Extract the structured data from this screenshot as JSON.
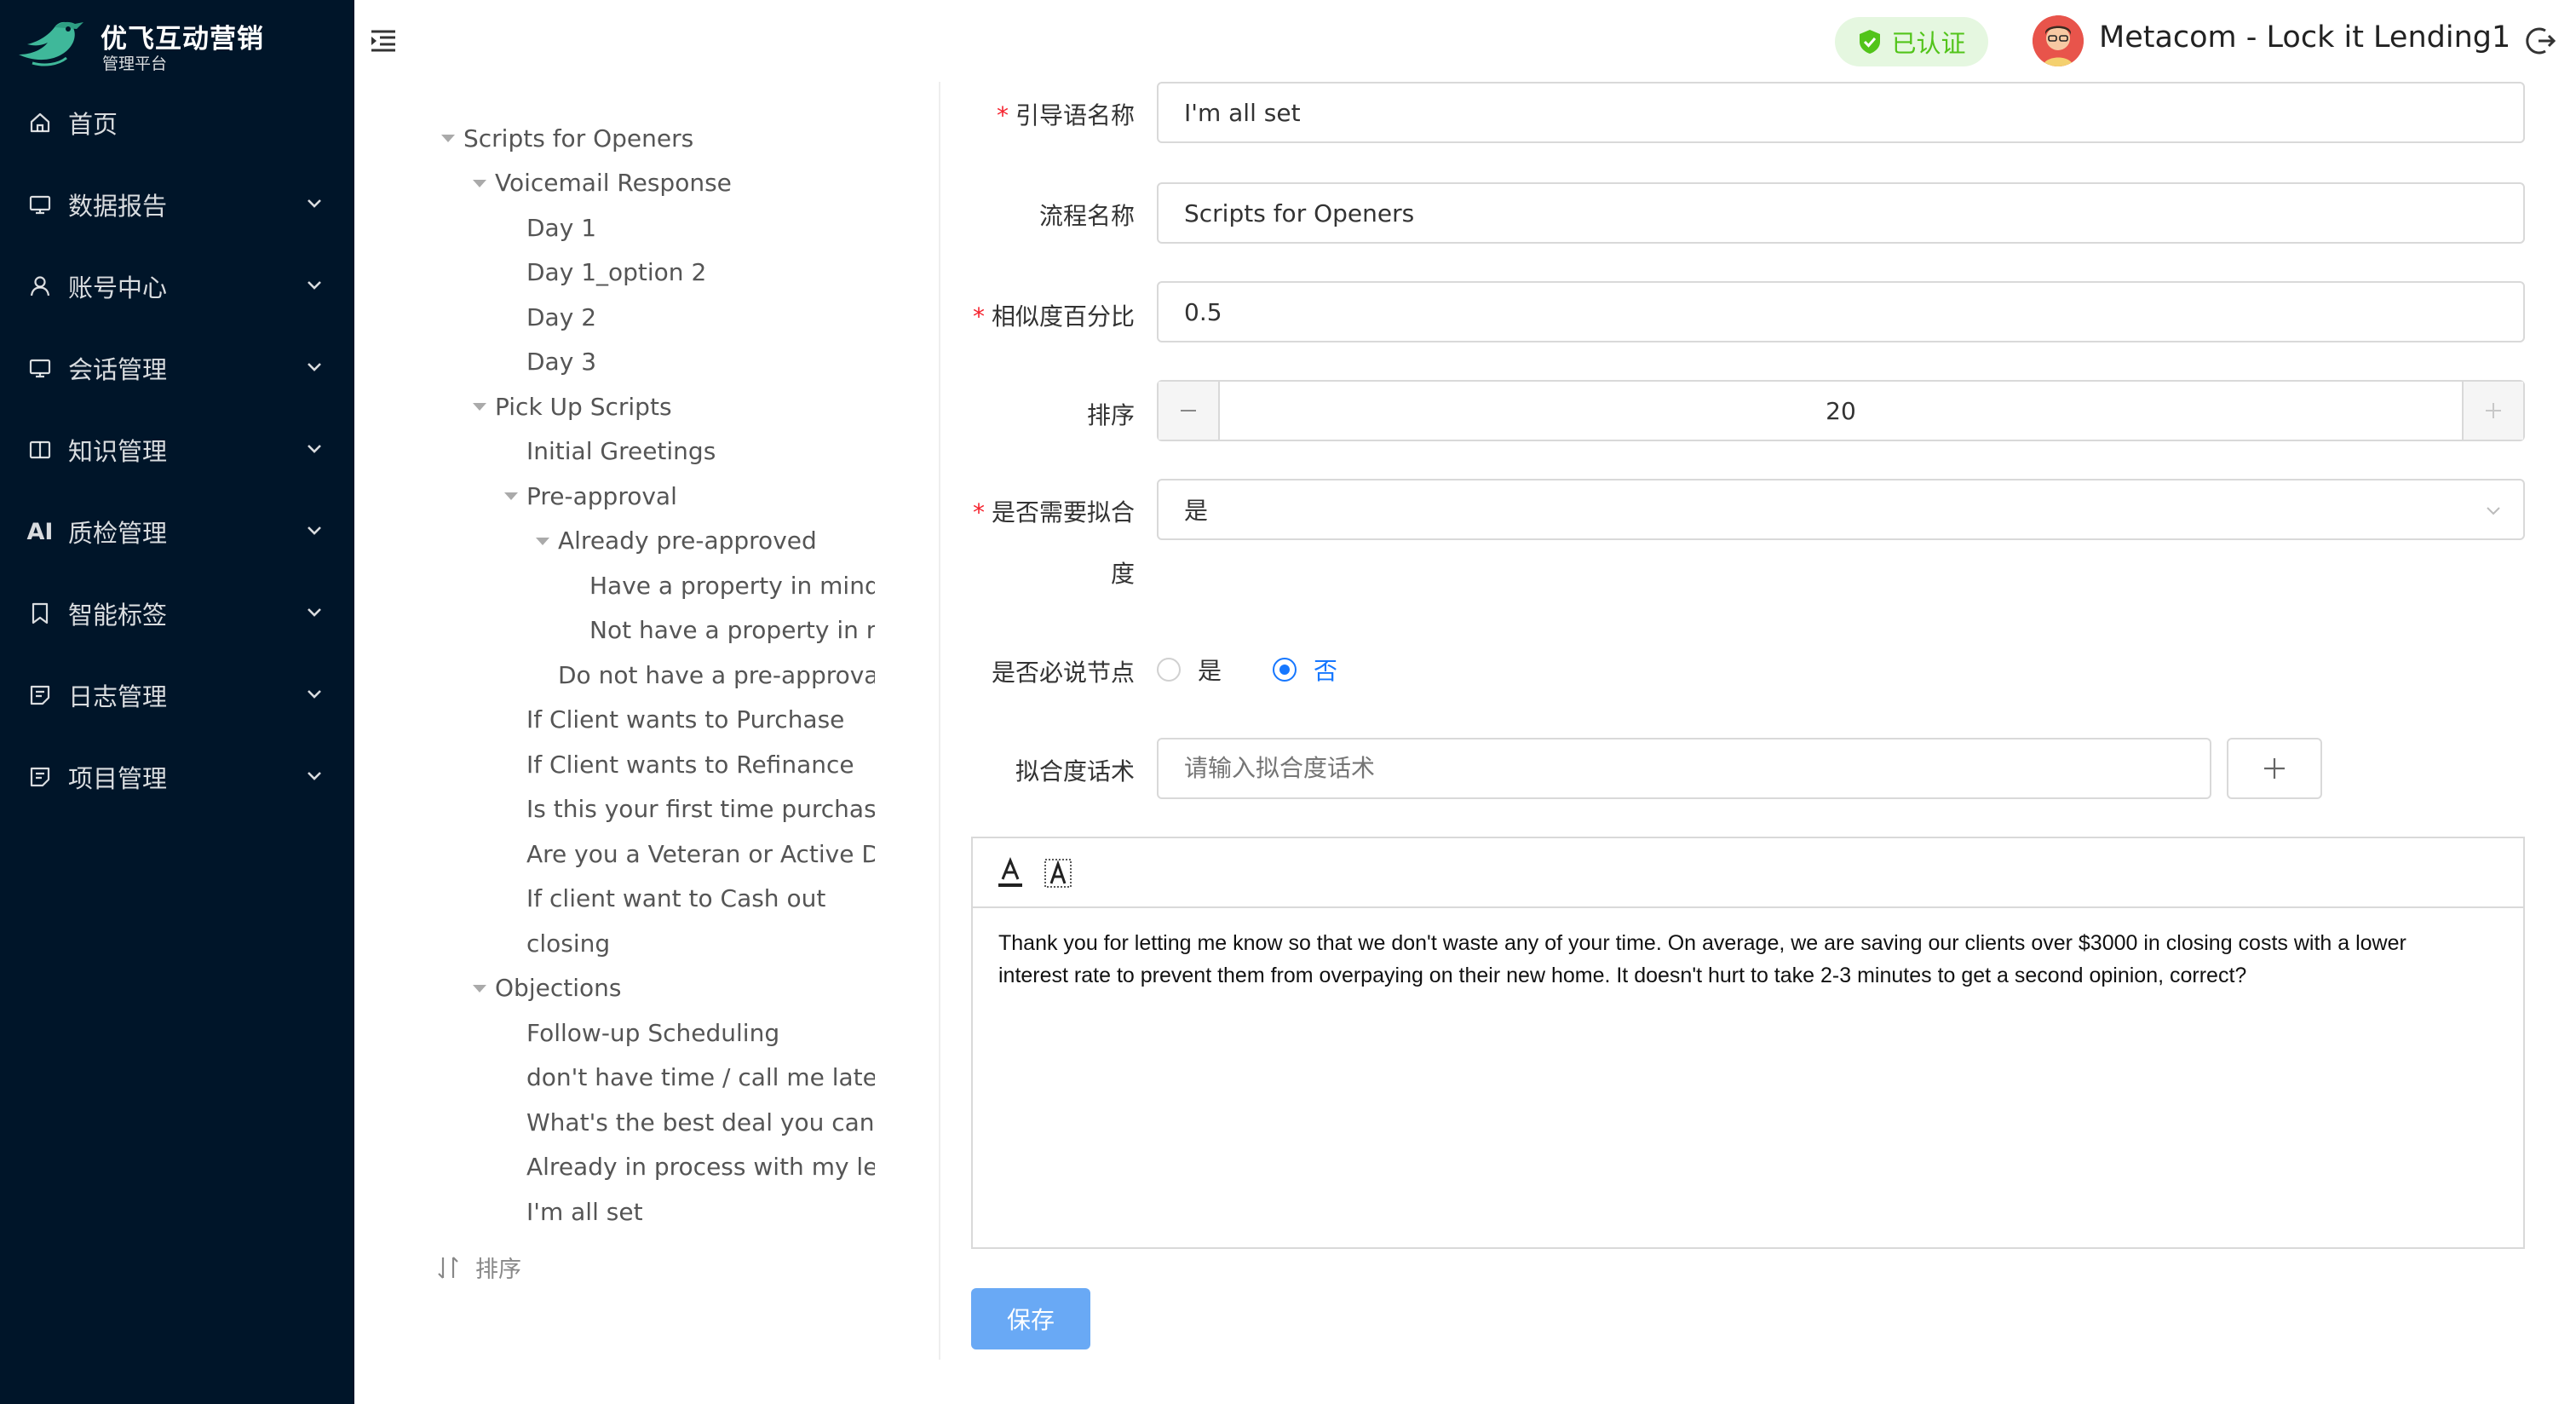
{
  "brand": {
    "title": "优飞互动营销",
    "subtitle": "管理平台"
  },
  "sidebar": {
    "items": [
      {
        "label": "首页",
        "icon": "home-icon",
        "has_submenu": false
      },
      {
        "label": "数据报告",
        "icon": "monitor-icon",
        "has_submenu": true
      },
      {
        "label": "账号中心",
        "icon": "user-icon",
        "has_submenu": true
      },
      {
        "label": "会话管理",
        "icon": "monitor-icon",
        "has_submenu": true
      },
      {
        "label": "知识管理",
        "icon": "book-icon",
        "has_submenu": true
      },
      {
        "label": "质检管理",
        "icon": "ai-icon",
        "icon_text": "AI",
        "has_submenu": true
      },
      {
        "label": "智能标签",
        "icon": "bookmark-icon",
        "has_submenu": true
      },
      {
        "label": "日志管理",
        "icon": "notes-icon",
        "has_submenu": true
      },
      {
        "label": "项目管理",
        "icon": "notes-icon",
        "has_submenu": true
      }
    ]
  },
  "header": {
    "verified_label": "已认证",
    "user_name": "Metacom - Lock it Lending1"
  },
  "tree": {
    "nodes": [
      {
        "label": "Scripts for Openers",
        "level": 0,
        "expandable": true
      },
      {
        "label": "Voicemail Response",
        "level": 1,
        "expandable": true
      },
      {
        "label": "Day 1",
        "level": 2,
        "expandable": false
      },
      {
        "label": "Day 1_option 2",
        "level": 2,
        "expandable": false
      },
      {
        "label": "Day 2",
        "level": 2,
        "expandable": false
      },
      {
        "label": "Day 3",
        "level": 2,
        "expandable": false
      },
      {
        "label": "Pick Up Scripts",
        "level": 1,
        "expandable": true
      },
      {
        "label": "Initial Greetings",
        "level": 2,
        "expandable": false
      },
      {
        "label": "Pre-approval",
        "level": 2,
        "expandable": true
      },
      {
        "label": "Already pre-approved",
        "level": 3,
        "expandable": true
      },
      {
        "label": "Have a property in mind",
        "level": 4,
        "expandable": false
      },
      {
        "label": "Not have a property in mi",
        "level": 4,
        "expandable": false
      },
      {
        "label": "Do not have a pre-approval",
        "level": 3,
        "expandable": false
      },
      {
        "label": "If Client wants to Purchase",
        "level": 2,
        "expandable": false
      },
      {
        "label": "If Client wants to Refinance",
        "level": 2,
        "expandable": false
      },
      {
        "label": "Is this your first time purchasing",
        "level": 2,
        "expandable": false
      },
      {
        "label": "Are you a Veteran or Active Dut",
        "level": 2,
        "expandable": false
      },
      {
        "label": "If client want to Cash out",
        "level": 2,
        "expandable": false
      },
      {
        "label": "closing",
        "level": 2,
        "expandable": false
      },
      {
        "label": "Objections",
        "level": 1,
        "expandable": true
      },
      {
        "label": "Follow-up Scheduling",
        "level": 2,
        "expandable": false
      },
      {
        "label": "don't have time / call me later",
        "level": 2,
        "expandable": false
      },
      {
        "label": "What's the best deal you can gi",
        "level": 2,
        "expandable": false
      },
      {
        "label": "Already in process with my lenc",
        "level": 2,
        "expandable": false
      },
      {
        "label": "I'm all set",
        "level": 2,
        "expandable": false
      }
    ],
    "sort_label": "排序"
  },
  "form": {
    "guide_name": {
      "label": "引导语名称",
      "required": true,
      "value": "I'm all set"
    },
    "flow_name": {
      "label": "流程名称",
      "required": false,
      "value": "Scripts for Openers"
    },
    "similarity": {
      "label": "相似度百分比",
      "required": true,
      "value": "0.5"
    },
    "order": {
      "label": "排序",
      "required": false,
      "value": "20"
    },
    "need_fit": {
      "label_line1": "是否需要拟合",
      "label_line2": "度",
      "required": true,
      "value": "是"
    },
    "must_say": {
      "label": "是否必说节点",
      "options": [
        "是",
        "否"
      ],
      "selected": "否"
    },
    "fit_phrase": {
      "label": "拟合度话术",
      "placeholder": "请输入拟合度话术"
    },
    "editor_text": "Thank you for letting me know so that we don't waste any of your time. On average, we are saving our clients over $3000 in closing costs with a lower interest rate to prevent them from overpaying on their new home. It doesn't hurt to take 2-3 minutes to get a second opinion, correct?",
    "save_label": "保存"
  },
  "colors": {
    "sidebar_bg": "#001529",
    "primary": "#1677ff",
    "save_button": "#69a9f5",
    "required_mark": "#f5222d",
    "verified_bg": "#e5f7e0",
    "verified_text": "#52c41a"
  }
}
